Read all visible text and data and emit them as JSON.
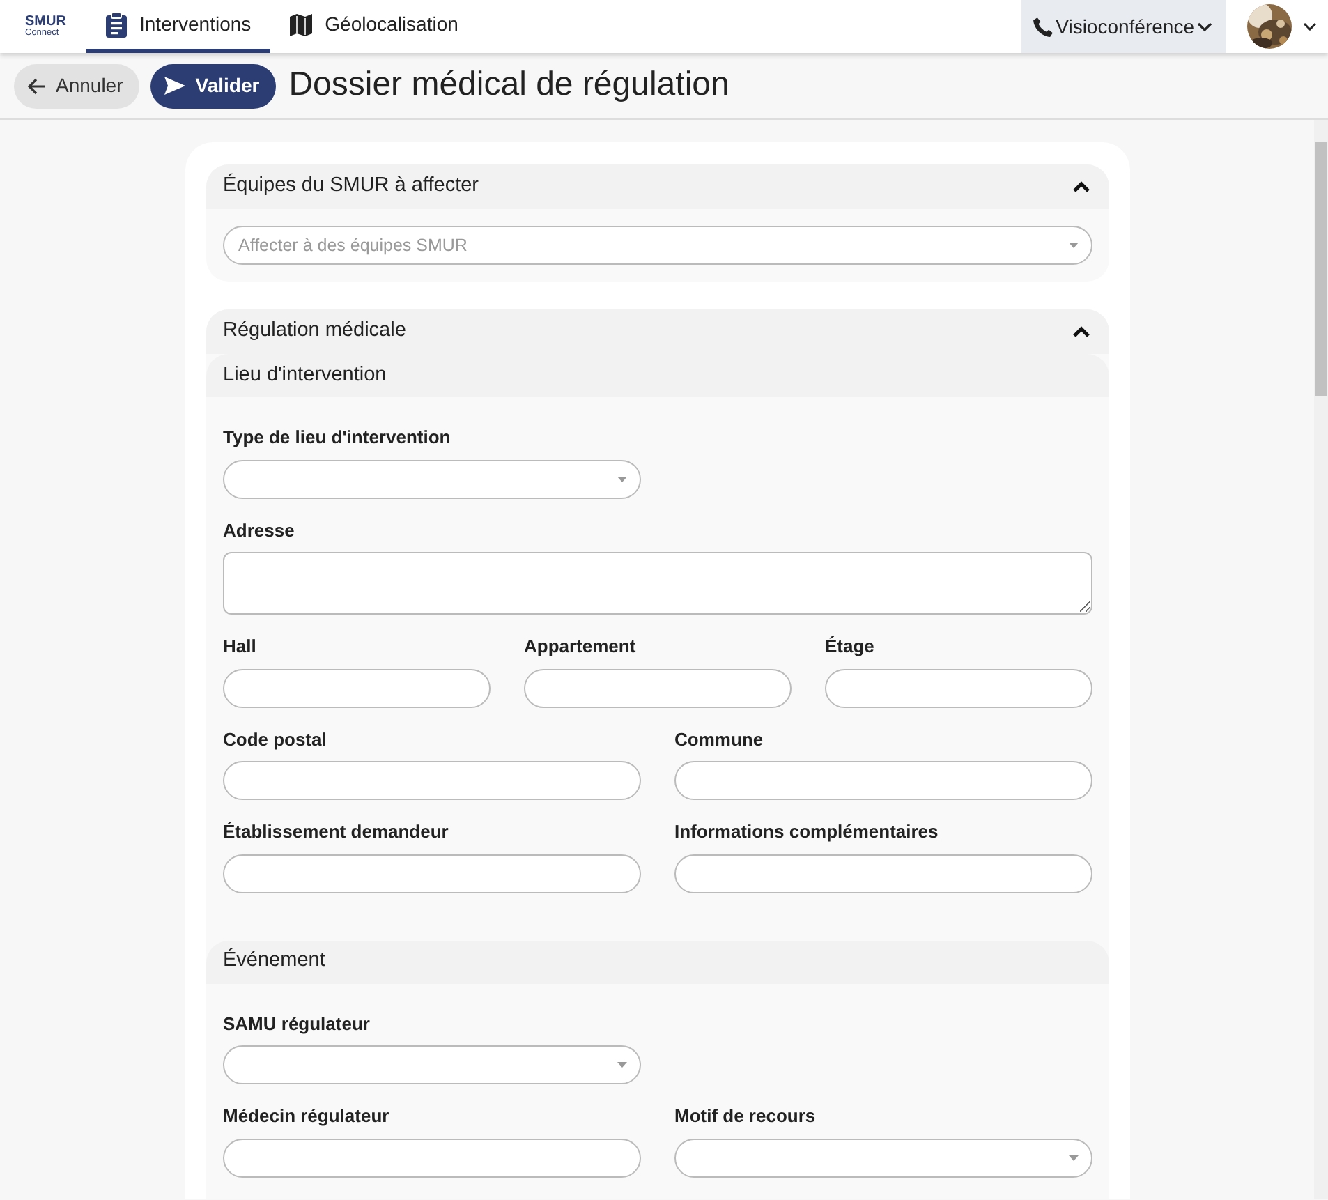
{
  "brand": {
    "name": "SMUR",
    "sub": "Connect"
  },
  "tabs": [
    {
      "label": "Interventions",
      "kind": "clipboard",
      "selected": true
    },
    {
      "label": "Géolocalisation",
      "kind": "map",
      "selected": false
    }
  ],
  "visio": {
    "label": "Visioconférence"
  },
  "toolbar": {
    "cancel": "Annuler",
    "validate": "Valider",
    "title": "Dossier médical de régulation"
  },
  "sections": [
    {
      "title": "Équipes du SMUR à affecter",
      "expanded": true,
      "select": {
        "placeholder": "Affecter à des équipes SMUR"
      }
    },
    {
      "title": "Régulation médicale",
      "expanded": true,
      "subsections": [
        {
          "title": "Lieu d'intervention",
          "rows": [
            [
              {
                "label": "Type de lieu d'intervention",
                "kind": "select"
              }
            ],
            [
              {
                "label": "Adresse",
                "kind": "textarea"
              }
            ],
            [
              {
                "label": "Hall",
                "kind": "input"
              },
              {
                "label": "Appartement",
                "kind": "input"
              },
              {
                "label": "Étage",
                "kind": "input"
              }
            ],
            [
              {
                "label": "Code postal",
                "kind": "input"
              },
              {
                "label": "Commune",
                "kind": "input"
              }
            ],
            [
              {
                "label": "Établissement demandeur",
                "kind": "input"
              },
              {
                "label": "Informations complémentaires",
                "kind": "input"
              }
            ]
          ]
        },
        {
          "title": "Événement",
          "rows": [
            [
              {
                "label": "SAMU régulateur",
                "kind": "select"
              }
            ],
            [
              {
                "label": "Médecin régulateur",
                "kind": "input"
              },
              {
                "label": "Motif de recours",
                "kind": "select"
              }
            ]
          ]
        }
      ]
    }
  ]
}
